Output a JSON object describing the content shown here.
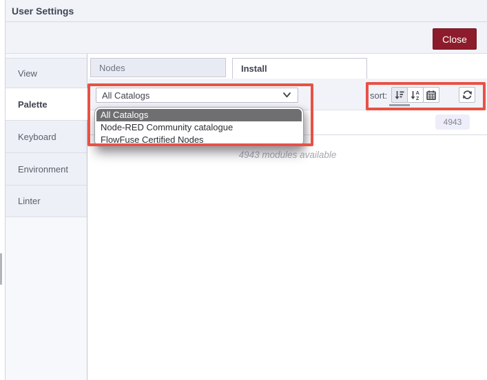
{
  "window": {
    "title": "User Settings",
    "close_label": "Close"
  },
  "sidebar": {
    "items": [
      {
        "label": "View",
        "selected": false
      },
      {
        "label": "Palette",
        "selected": true
      },
      {
        "label": "Keyboard",
        "selected": false
      },
      {
        "label": "Environment",
        "selected": false
      },
      {
        "label": "Linter",
        "selected": false
      }
    ]
  },
  "main": {
    "tabs": [
      {
        "label": "Nodes",
        "selected": false
      },
      {
        "label": "Install",
        "selected": true
      }
    ],
    "toolbar": {
      "catalog_select": {
        "value": "All Catalogs",
        "options": [
          "All Catalogs",
          "Node-RED Community catalogue",
          "FlowFuse Certified Nodes"
        ],
        "selected_index": 0
      },
      "sort_label": "sort:",
      "sort_buttons": [
        {
          "name": "sort-recommended",
          "icon": "sort-amount-desc-icon",
          "active": true
        },
        {
          "name": "sort-alphabetical",
          "icon": "sort-alpha-icon",
          "active": false
        },
        {
          "name": "sort-recent",
          "icon": "calendar-icon",
          "active": false
        }
      ],
      "refresh_icon": "refresh-icon"
    },
    "count_badge": "4943",
    "status_text": "4943 modules available"
  },
  "annotations": {
    "highlight_color": "#e85144",
    "highlighted_regions": [
      "catalog-dropdown",
      "sort-controls"
    ]
  }
}
